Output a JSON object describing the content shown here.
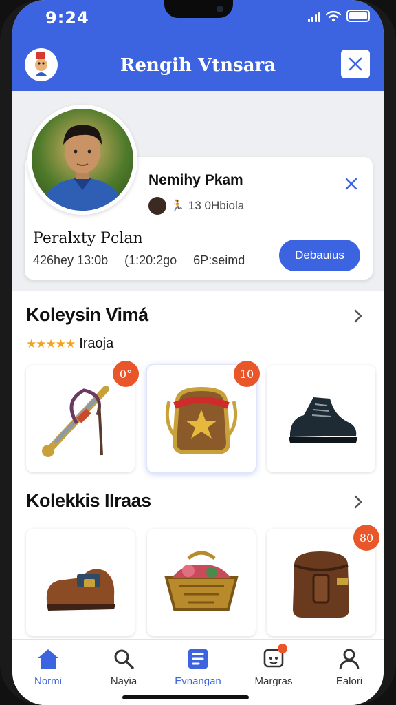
{
  "status_bar": {
    "time": "9:24"
  },
  "app_bar": {
    "title": "Rengih Vtnsara"
  },
  "profile": {
    "name": "Nemihy Pkam",
    "meta": "13 0Hbiola",
    "subtitle": "Peralxty Pclan",
    "stats": [
      "426hey 13:0b",
      "(1:20:2go",
      "6P:seimd"
    ],
    "details_label": "Debauius"
  },
  "section1": {
    "title": "Koleysin Vimá",
    "rating_label": "Iraoja",
    "stars": "★★★★★",
    "items": [
      {
        "name": "rope-sword",
        "badge": "0°"
      },
      {
        "name": "red-backpack",
        "badge": "10"
      },
      {
        "name": "black-boot",
        "badge": ""
      }
    ]
  },
  "section2": {
    "title": "Kolekkis IIraas",
    "items": [
      {
        "name": "brown-shoe",
        "badge": ""
      },
      {
        "name": "treasure-chest",
        "badge": ""
      },
      {
        "name": "leather-bag",
        "badge": "80"
      }
    ]
  },
  "nav": {
    "items": [
      {
        "label": "Normi",
        "icon": "home-icon"
      },
      {
        "label": "Nayia",
        "icon": "search-icon"
      },
      {
        "label": "Evnangan",
        "icon": "list-icon"
      },
      {
        "label": "Margras",
        "icon": "message-icon"
      },
      {
        "label": "Ealori",
        "icon": "profile-icon"
      }
    ]
  },
  "colors": {
    "primary": "#3d64e0",
    "badge": "#e8562a",
    "star": "#f2a31b"
  }
}
